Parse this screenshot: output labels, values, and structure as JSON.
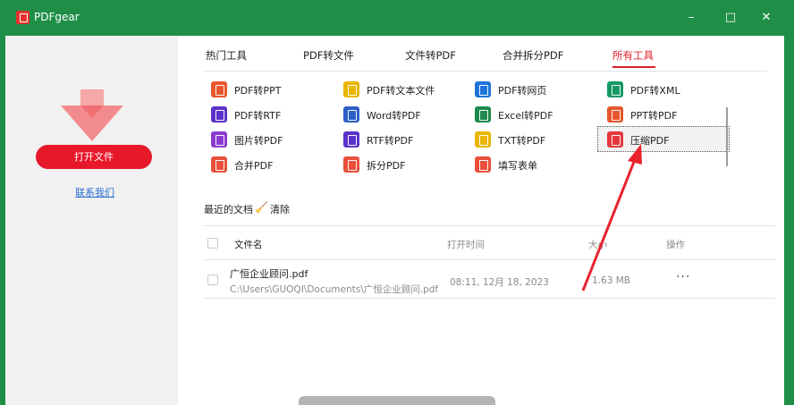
{
  "app": {
    "title": "PDFgear"
  },
  "window_controls": {
    "minimize": "–",
    "maximize": "□",
    "close": "✕"
  },
  "sidebar": {
    "open_file_label": "打开文件",
    "contact_label": "联系我们"
  },
  "tabs": [
    {
      "label": "热门工具",
      "active": false
    },
    {
      "label": "PDF转文件",
      "active": false
    },
    {
      "label": "文件转PDF",
      "active": false
    },
    {
      "label": "合并拆分PDF",
      "active": false
    },
    {
      "label": "所有工具",
      "active": true
    }
  ],
  "tools": [
    {
      "label": "PDF转PPT",
      "color": "#e8562e",
      "icon": "ppt-icon"
    },
    {
      "label": "PDF转文本文件",
      "color": "#e9b500",
      "icon": "text-icon"
    },
    {
      "label": "PDF转网页",
      "color": "#1f74d9",
      "icon": "web-icon"
    },
    {
      "label": "PDF转XML",
      "color": "#139a63",
      "icon": "xml-icon"
    },
    {
      "label": "PDF转RTF",
      "color": "#5a32c9",
      "icon": "rtf-icon"
    },
    {
      "label": "Word转PDF",
      "color": "#2a5fc7",
      "icon": "word-icon"
    },
    {
      "label": "Excel转PDF",
      "color": "#1e8a4c",
      "icon": "excel-icon"
    },
    {
      "label": "PPT转PDF",
      "color": "#e8562e",
      "icon": "ppt-icon"
    },
    {
      "label": "图片转PDF",
      "color": "#8a3ad0",
      "icon": "image-icon"
    },
    {
      "label": "RTF转PDF",
      "color": "#5a32c9",
      "icon": "rtf-icon"
    },
    {
      "label": "TXT转PDF",
      "color": "#e9b500",
      "icon": "txt-icon"
    },
    {
      "label": "压缩PDF",
      "color": "#e5373c",
      "icon": "compress-icon",
      "highlighted": true
    },
    {
      "label": "合并PDF",
      "color": "#e94f3a",
      "icon": "merge-icon"
    },
    {
      "label": "拆分PDF",
      "color": "#e94f3a",
      "icon": "split-icon"
    },
    {
      "label": "填写表单",
      "color": "#e94f3a",
      "icon": "form-icon"
    }
  ],
  "recent": {
    "title": "最近的文档",
    "clear_label": "清除",
    "columns": {
      "name": "文件名",
      "opened": "打开时间",
      "size": "大小",
      "actions": "操作"
    },
    "files": [
      {
        "name": "广恒企业顾问.pdf",
        "path": "C:\\Users\\GUOQI\\Documents\\广恒企业顾问.pdf",
        "opened": "08:11, 12月 18, 2023",
        "size": "1.63 MB",
        "more": "···"
      }
    ]
  },
  "colors": {
    "titlebar": "#1f8f48",
    "accent": "#e8182b",
    "active_tab": "#e0202a",
    "annotation": "#e8232d"
  }
}
